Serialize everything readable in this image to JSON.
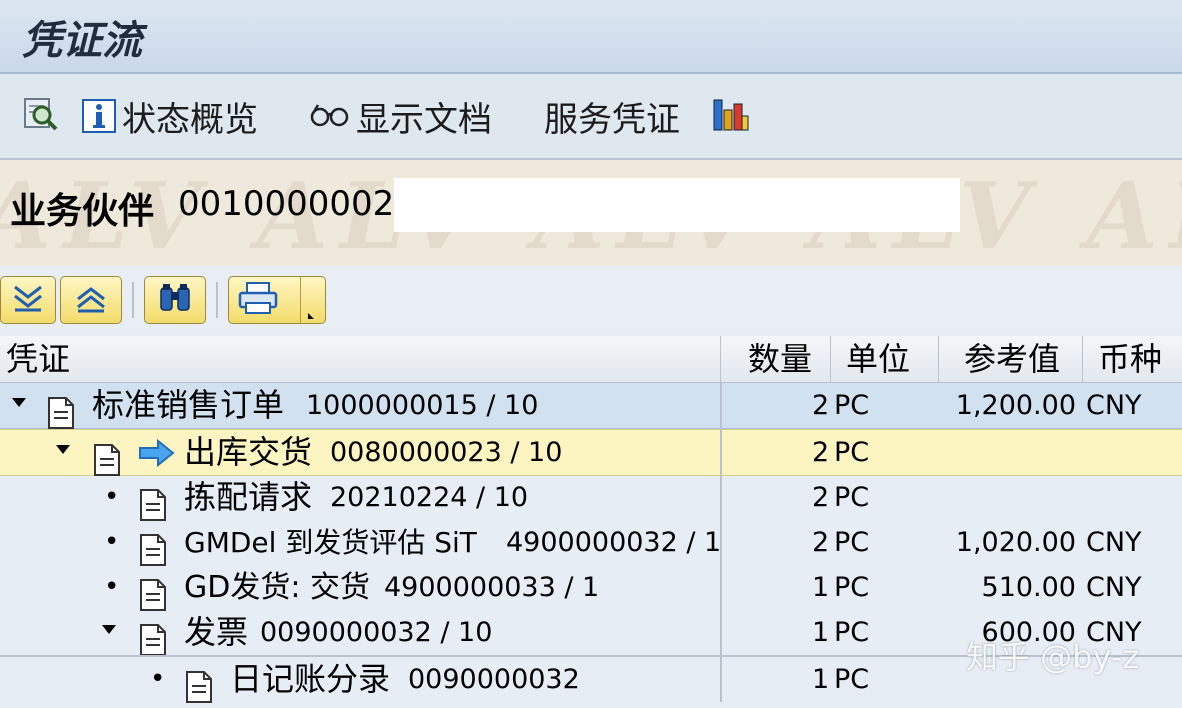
{
  "window": {
    "title": "凭证流"
  },
  "toolbar": {
    "status_overview": "状态概览",
    "display_doc": "显示文档",
    "service_doc": "服务凭证"
  },
  "partner": {
    "label": "业务伙伴",
    "value": "0010000002 ,",
    "watermark": "ALV ALV ALV ALV ALV"
  },
  "grid": {
    "headers": {
      "doc": "凭证",
      "qty": "数量",
      "unit": "单位",
      "ref": "参考值",
      "cur": "币种"
    },
    "rows": [
      {
        "name": "标准销售订单",
        "num": "1000000015 / 10",
        "qty": "2",
        "unit": "PC",
        "ref": "1,200.00",
        "cur": "CNY"
      },
      {
        "name": "出库交货",
        "num": "0080000023 / 10",
        "qty": "2",
        "unit": "PC",
        "ref": "",
        "cur": ""
      },
      {
        "name": "拣配请求",
        "num": "20210224 / 10",
        "qty": "2",
        "unit": "PC",
        "ref": "",
        "cur": ""
      },
      {
        "name": "GMDel 到发货评估 SiT",
        "num": "4900000032 / 1",
        "qty": "2",
        "unit": "PC",
        "ref": "1,020.00",
        "cur": "CNY"
      },
      {
        "name": "GD发货: 交货",
        "num": "4900000033 / 1",
        "qty": "1",
        "unit": "PC",
        "ref": "510.00",
        "cur": "CNY"
      },
      {
        "name": "发票",
        "num": "0090000032 / 10",
        "qty": "1",
        "unit": "PC",
        "ref": "600.00",
        "cur": "CNY"
      },
      {
        "name": "日记账分录",
        "num": "0090000032",
        "qty": "1",
        "unit": "PC",
        "ref": "",
        "cur": ""
      }
    ]
  },
  "watermark_text": "知乎 @by-z",
  "colors": {
    "row_selected": "#d1e1f0",
    "row_highlight": "#fcf5c2",
    "toolbar_bg": "#dfe7ef",
    "button_yellow": "#f3dc6a",
    "arrow_blue": "#1f8ce0"
  },
  "icons": [
    "find-icon",
    "info-icon",
    "glasses-icon",
    "chart-icon",
    "expand-all-icon",
    "collapse-all-icon",
    "binoculars-icon",
    "print-icon",
    "dropdown-arrow-icon",
    "tree-expand-icon",
    "tree-bullet-icon",
    "document-icon",
    "arrow-right-icon"
  ]
}
